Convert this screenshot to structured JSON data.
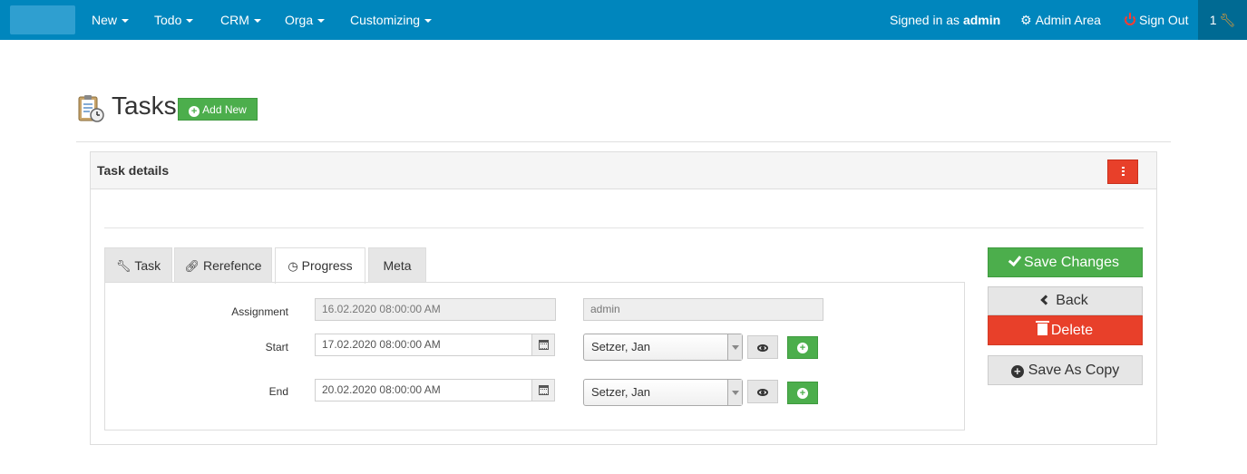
{
  "navbar": {
    "menus": [
      {
        "label": "New"
      },
      {
        "label": "Todo"
      },
      {
        "label": "CRM"
      },
      {
        "label": "Orga"
      },
      {
        "label": "Customizing"
      }
    ],
    "signed_in_prefix": "Signed in as",
    "signed_in_user": "admin",
    "admin_area": "Admin Area",
    "sign_out": "Sign Out",
    "user_count": "1"
  },
  "header": {
    "title": "Tasks",
    "add_new": "Add New"
  },
  "panel": {
    "title": "Task details"
  },
  "tabs": [
    {
      "label": "Task",
      "icon": "wrench-icon",
      "active": false
    },
    {
      "label": "Rerefence",
      "icon": "link-icon",
      "active": false
    },
    {
      "label": "Progress",
      "icon": "clock-icon",
      "active": true
    },
    {
      "label": "Meta",
      "icon": "",
      "active": false
    }
  ],
  "form": {
    "assignment": {
      "label": "Assignment",
      "date": "16.02.2020 08:00:00 AM",
      "user": "admin"
    },
    "start": {
      "label": "Start",
      "date": "17.02.2020 08:00:00 AM",
      "person": "Setzer, Jan"
    },
    "end": {
      "label": "End",
      "date": "20.02.2020 08:00:00 AM",
      "person": "Setzer, Jan"
    }
  },
  "actions": {
    "save": "Save Changes",
    "back": "Back",
    "delete": "Delete",
    "save_copy": "Save As Copy"
  },
  "colors": {
    "navbar": "#0086bd",
    "success": "#4cae4c",
    "danger": "#e8402a"
  }
}
